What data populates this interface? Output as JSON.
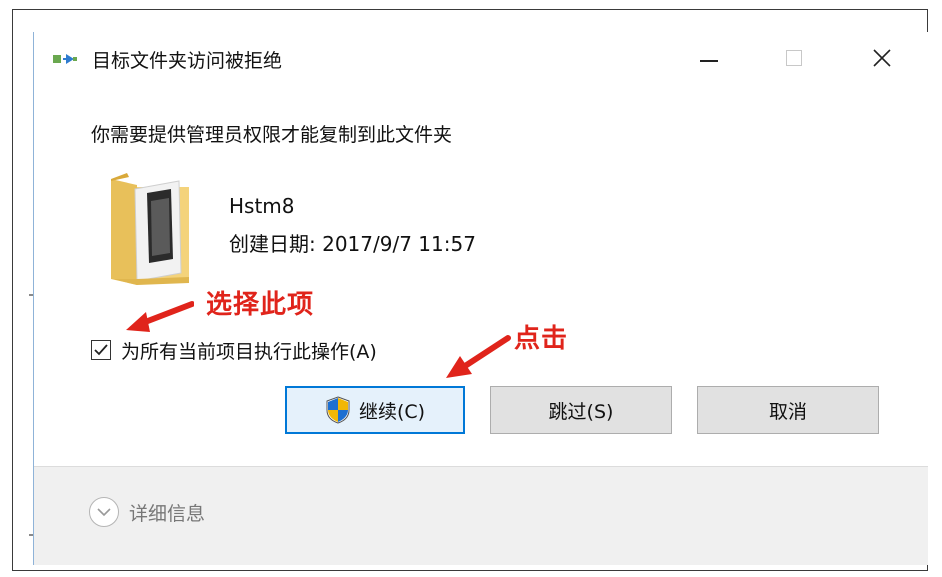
{
  "window": {
    "title": "目标文件夹访问被拒绝",
    "icons": {
      "app": "copy-to-folder-icon",
      "minimize": "minimize-icon",
      "maximize": "maximize-icon",
      "close": "close-icon"
    },
    "close_glyph": "✕"
  },
  "dialog": {
    "message": "你需要提供管理员权限才能复制到此文件夹",
    "item": {
      "icon": "folder-icon",
      "name": "Hstm8",
      "created": "创建日期: 2017/9/7 11:57"
    },
    "checkbox": {
      "label": "为所有当前项目执行此操作(A)",
      "checked": true
    },
    "buttons": {
      "continue_label": "继续(C)",
      "continue_icon": "uac-shield-icon",
      "skip_label": "跳过(S)",
      "cancel_label": "取消"
    },
    "details_label": "详细信息"
  },
  "annotations": {
    "select_hint": "选择此项",
    "click_hint": "点击",
    "color": "#e0241b"
  },
  "colors": {
    "accent": "#0078d7",
    "button_bg": "#e1e1e1",
    "footer_bg": "#f0f0f0"
  }
}
